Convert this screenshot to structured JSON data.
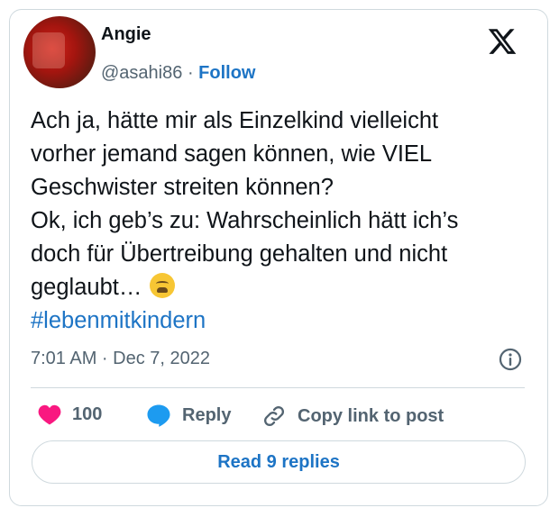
{
  "author": {
    "name": "Angie",
    "handle": "@asahi86",
    "separator": "·",
    "follow_label": "Follow"
  },
  "tweet": {
    "lines": [
      "Ach ja, hätte mir als Einzelkind vielleicht",
      "vorher jemand sagen können, wie VIEL",
      "Geschwister streiten können?",
      "Ok, ich geb’s zu: Wahrscheinlich hätt ich’s",
      "doch für Übertreibung gehalten und nicht",
      "geglaubt…"
    ],
    "hashtag": "#lebenmitkindern",
    "emoji": "weary-face-emoji"
  },
  "timestamp": "7:01 AM · Dec 7, 2022",
  "actions": {
    "like_count": "100",
    "reply_label": "Reply",
    "copy_link_label": "Copy link to post"
  },
  "read_replies_label": "Read 9 replies",
  "icons": {
    "logo": "x-logo-icon",
    "info": "info-icon",
    "like": "heart-icon",
    "reply": "speech-bubble-icon",
    "copy": "link-icon"
  },
  "colors": {
    "accent": "#1d74c5",
    "like": "#f91880",
    "secondary_text": "#536471",
    "border": "#cfd9de"
  }
}
